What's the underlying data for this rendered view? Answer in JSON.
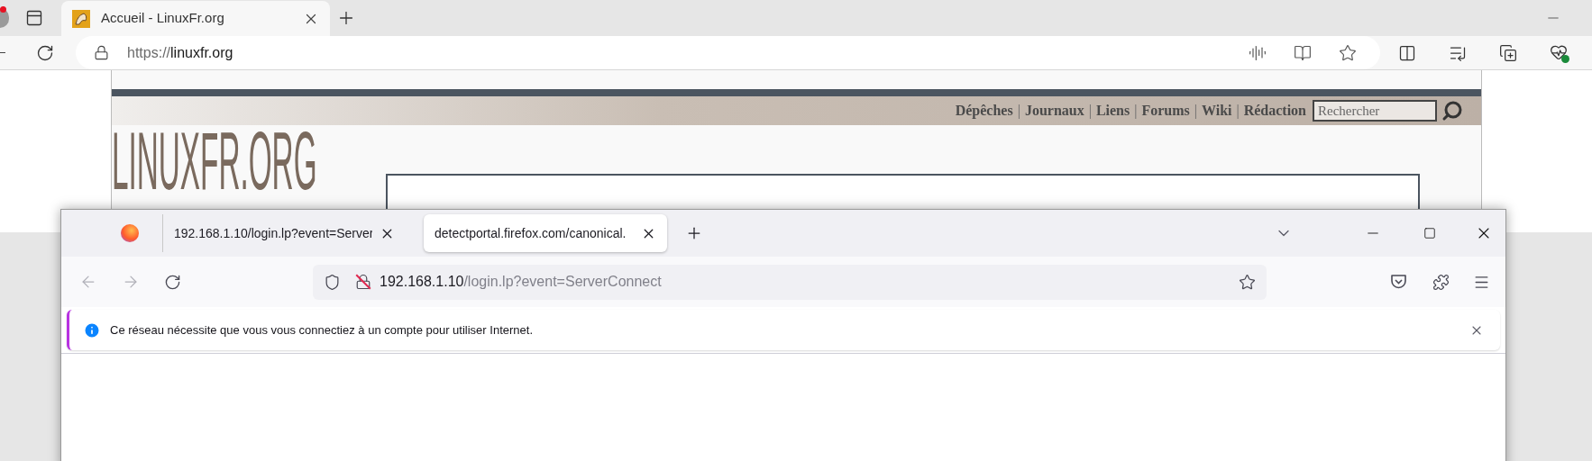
{
  "edge": {
    "tab": {
      "title": "Accueil - LinuxFr.org",
      "selected": true
    },
    "address": {
      "scheme": "https://",
      "host": "linuxfr.org"
    }
  },
  "page": {
    "nav": [
      {
        "kind": "link",
        "text": "Dépêches"
      },
      {
        "kind": "separator",
        "text": "|"
      },
      {
        "kind": "link",
        "text": "Journaux"
      },
      {
        "kind": "separator",
        "text": "|"
      },
      {
        "kind": "link",
        "text": "Liens"
      },
      {
        "kind": "separator",
        "text": "|"
      },
      {
        "kind": "link",
        "text": "Forums"
      },
      {
        "kind": "separator",
        "text": "|"
      },
      {
        "kind": "link",
        "text": "Wiki"
      },
      {
        "kind": "separator",
        "text": "|"
      },
      {
        "kind": "link",
        "text": "Rédaction"
      }
    ],
    "search": {
      "placeholder": "Rechercher"
    },
    "logo": "LINUXFR.ORG"
  },
  "firefox": {
    "tabs": [
      {
        "title": "192.168.1.10/login.lp?event=Server",
        "selected": false
      },
      {
        "title": "detectportal.firefox.com/canonical.",
        "selected": true
      }
    ],
    "address": {
      "host": "192.168.1.10",
      "path": "/login.lp?event=ServerConnect"
    },
    "notification": {
      "text": "Ce réseau nécessite que vous vous connectiez à un compte pour utiliser Internet."
    }
  }
}
